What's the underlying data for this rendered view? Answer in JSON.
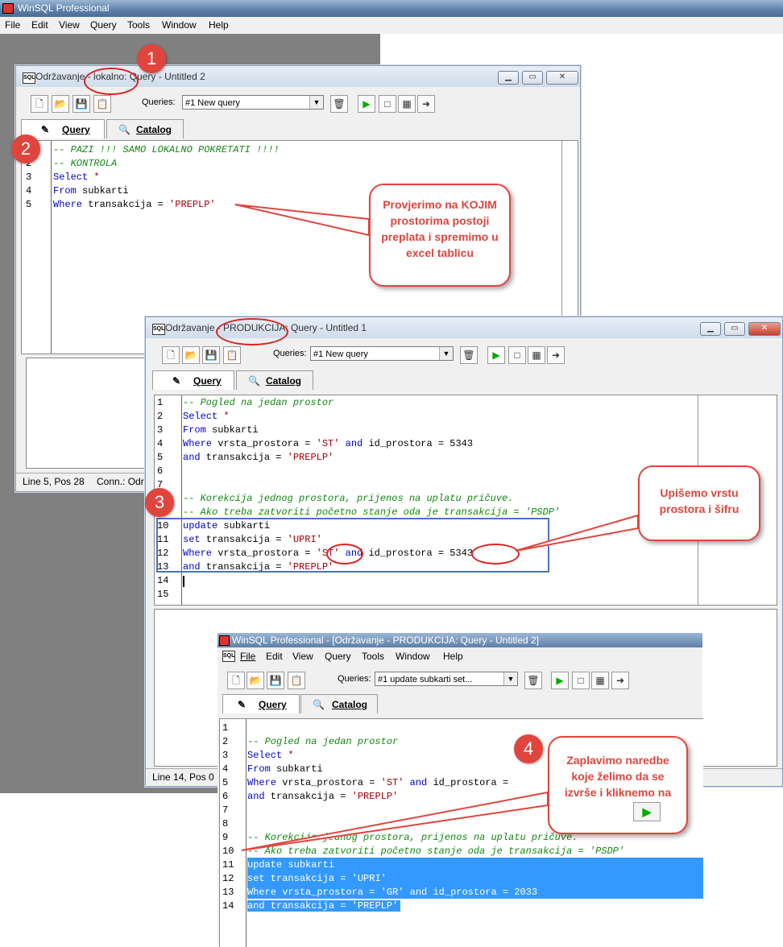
{
  "app": {
    "title": "WinSQL Professional"
  },
  "menu": {
    "file": "File",
    "edit": "Edit",
    "view": "View",
    "query": "Query",
    "tools": "Tools",
    "window": "Window",
    "help": "Help"
  },
  "win1": {
    "title": "Održavanje - lokalno: Query - Untitled 2",
    "queries_label": "Queries:",
    "queries_value": "#1 New query",
    "tab_query": "Query",
    "tab_catalog": "Catalog",
    "lines": [
      "1",
      "2",
      "3",
      "4",
      "5"
    ],
    "status_pos": "Line 5, Pos 28",
    "status_conn": "Conn.: Odr"
  },
  "win2": {
    "title": "Održavanje - PRODUKCIJA: Query - Untitled 1",
    "queries_label": "Queries:",
    "queries_value": "#1 New query",
    "tab_query": "Query",
    "tab_catalog": "Catalog",
    "lines": [
      "1",
      "2",
      "3",
      "4",
      "5",
      "6",
      "7",
      "8",
      "9",
      "10",
      "11",
      "12",
      "13",
      "14",
      "15"
    ],
    "status_pos": "Line 14, Pos 0"
  },
  "win3": {
    "title": "WinSQL Professional - [Održavanje - PRODUKCIJA: Query - Untitled 2]",
    "queries_label": "Queries:",
    "queries_value": "#1 update subkarti  set...",
    "tab_query": "Query",
    "tab_catalog": "Catalog",
    "lines": [
      "1",
      "2",
      "3",
      "4",
      "5",
      "6",
      "7",
      "8",
      "9",
      "10",
      "11",
      "12",
      "13",
      "14"
    ]
  },
  "callouts": {
    "c1": "Provjerimo na KOJIM prostorima postoji preplata i spremimo u excel tablicu",
    "c2": "Upišemo vrstu prostora i šifru",
    "c3": "Zaplavimo naredbe koje želimo da se izvrše i kliknemo na"
  },
  "badges": {
    "b1": "1",
    "b2": "2",
    "b3": "3",
    "b4": "4"
  },
  "colors": {
    "callout": "#e0453d",
    "selection": "#3399ff",
    "keyword": "#0000cc",
    "comment": "#118811",
    "string": "#a0000a"
  }
}
